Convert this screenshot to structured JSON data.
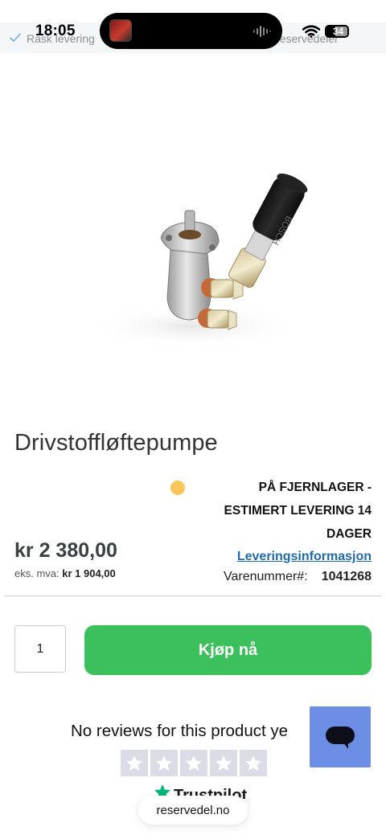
{
  "status_bar": {
    "time": "18:05",
    "battery": "34"
  },
  "info_strip": {
    "left_text": "Rask levering",
    "right_text": "reservedeler"
  },
  "product": {
    "title": "Drivstoffløftepumpe",
    "image_alt": "BOSCH",
    "stock_status": "PÅ FJERNLAGER - ESTIMERT LEVERING 14 DAGER",
    "stock_color": "#f8c65a",
    "price": "kr 2 380,00",
    "price_ex_label": "eks. mva:",
    "price_ex_value": "kr 1 904,00",
    "delivery_link": "Leveringsinformasjon",
    "sku_label": "Varenummer#:",
    "sku_value": "1041268"
  },
  "cart": {
    "quantity": "1",
    "buy_label": "Kjøp nå",
    "buy_color": "#3cc05b"
  },
  "reviews": {
    "text": "No reviews for this product ye",
    "rating": 0,
    "max_rating": 5,
    "provider": "Trustpilot"
  },
  "chat": {
    "icon": "chat-bubble-icon",
    "color": "#6c8ee4"
  },
  "browser": {
    "url": "reservedel.no"
  }
}
